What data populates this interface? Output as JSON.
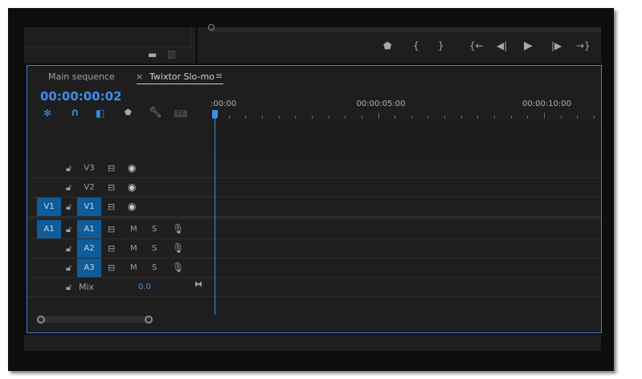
{
  "project_panel": {
    "icons": [
      "folder-icon",
      "trash-icon"
    ]
  },
  "monitor": {
    "controls": [
      "marker",
      "mark-in",
      "mark-out",
      "go-to-in",
      "step-back",
      "play",
      "step-forward",
      "go-to-out"
    ]
  },
  "timeline": {
    "tabs": [
      {
        "label": "Main sequence",
        "active": false
      },
      {
        "label": "Twixtor Slo-mo",
        "active": true
      }
    ],
    "close_glyph": "×",
    "menu_glyph": "≡",
    "timecode": "00:00:00:02",
    "tools": [
      "snap-icon",
      "magnet-icon",
      "linked-selection-icon",
      "marker-icon",
      "wrench-icon",
      "captions-icon"
    ],
    "cc_label": "CC",
    "ruler": {
      "labels": [
        {
          "text": ":00:00",
          "sec": 0
        },
        {
          "text": "00:00:05:00",
          "sec": 5
        },
        {
          "text": "00:00:10:00",
          "sec": 10
        }
      ],
      "playhead_sec": 0.07
    },
    "video_tracks": [
      {
        "src": "",
        "name": "V3"
      },
      {
        "src": "",
        "name": "V2"
      },
      {
        "src": "V1",
        "name": "V1"
      }
    ],
    "audio_tracks": [
      {
        "src": "A1",
        "name": "A1"
      },
      {
        "src": "",
        "name": "A2"
      },
      {
        "src": "",
        "name": "A3"
      }
    ],
    "mute_label": "M",
    "solo_label": "S",
    "mix": {
      "label": "Mix",
      "value": "0.0"
    }
  },
  "colors": {
    "accent": "#3d8fe6",
    "track_button": "#0f5c9a"
  }
}
